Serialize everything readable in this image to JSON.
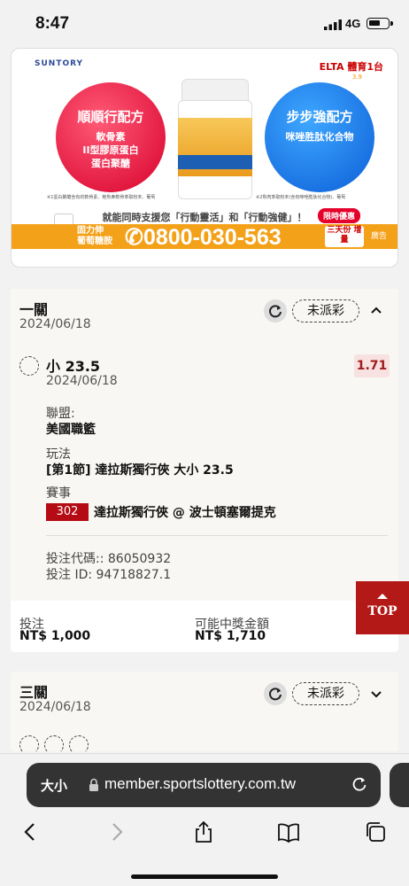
{
  "status_bar": {
    "time": "8:47",
    "network": "4G"
  },
  "ad": {
    "brand": "SUNTORY",
    "partner": "ELTA 體育1台",
    "partner_sub": "3.9",
    "left_circle": {
      "title": "順順行配方",
      "lines": [
        "軟骨素",
        "II型膠原蛋白",
        "蛋白聚醣"
      ],
      "note": "※1"
    },
    "right_circle": {
      "title": "步步強配方",
      "lines": [
        "咪唑胜肽化合物"
      ],
      "note": "※2"
    },
    "fine_left": "※1蛋白聚醣含有的軟骨素、鮭魚鼻軟骨萃取粉末、葡萄",
    "fine_right": "※2魚肉萃取粉末(含有咪唑胜肽化合物)、葡萄",
    "slogan": "就能同時支援您「行動靈活」和「行動強健」！",
    "limited": "限時優惠",
    "product_name": "固力伸 葡萄糖胺",
    "phone": "0800-030-563",
    "promo": "三天份 增量",
    "ad_label": "廣告"
  },
  "bet1": {
    "title": "一關",
    "date": "2024/06/18",
    "status": "未派彩",
    "selection": "小 23.5",
    "selection_date": "2024/06/18",
    "odds": "1.71",
    "league_label": "聯盟:",
    "league": "美國職籃",
    "play_label": "玩法",
    "play": "[第1節] 達拉斯獨行俠 大小 23.5",
    "event_label": "賽事",
    "game_code": "302",
    "game": "達拉斯獨行俠 @ 波士頓塞爾提克",
    "bet_code": "投注代碼:: 86050932",
    "bet_id": "投注 ID: 94718827.1",
    "stake_label": "投注",
    "stake": "NT$ 1,000",
    "payout_label": "可能中獎金額",
    "payout": "NT$ 1,710"
  },
  "top_button": "TOP",
  "bet2": {
    "title": "三關",
    "date": "2024/06/18",
    "status": "未派彩"
  },
  "browser": {
    "text_size": "大小",
    "url": "member.sportslottery.com.tw"
  }
}
